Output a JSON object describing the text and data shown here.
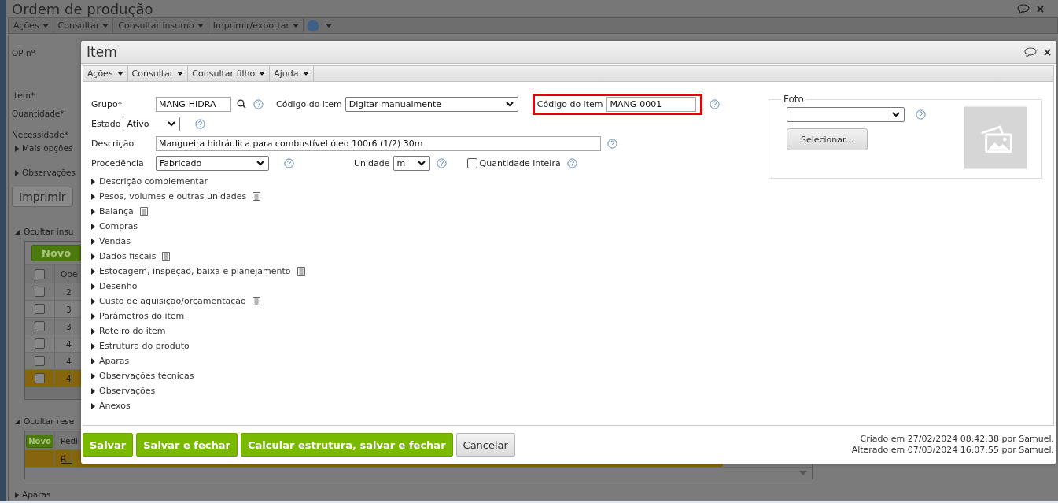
{
  "background_window": {
    "title": "Ordem de produção",
    "menu": [
      "Ações",
      "Consultar",
      "Consultar insumo",
      "Imprimir/exportar"
    ],
    "labels": [
      "OP nº",
      "Item*",
      "Quantidade*",
      "Necessidade*"
    ],
    "more_options": "Mais opções",
    "observations": "Observações",
    "print_button": "Imprimir",
    "inputs_section": {
      "toggle": "Ocultar insu",
      "new_button": "Novo",
      "column_2": "Ope",
      "all_checked": false,
      "rows": [
        {
          "cell": "2",
          "checked": false,
          "selected": false
        },
        {
          "cell": "3",
          "checked": false,
          "selected": false
        },
        {
          "cell": "3",
          "checked": false,
          "selected": false
        },
        {
          "cell": "4",
          "checked": false,
          "selected": false
        },
        {
          "cell": "4",
          "checked": false,
          "selected": false
        },
        {
          "cell": "4",
          "checked": false,
          "selected": true
        }
      ]
    },
    "reservations_section": {
      "toggle": "Ocultar rese",
      "new_button": "Novo",
      "column_2": "Pedi",
      "rows": [
        {
          "cell": "R -",
          "selected": true
        }
      ]
    },
    "next_section": "Aparas"
  },
  "dialog": {
    "title": "Item",
    "menu": [
      "Ações",
      "Consultar",
      "Consultar filho",
      "Ajuda"
    ],
    "group": {
      "label": "Grupo*",
      "value": "MANG-HIDRA"
    },
    "code_mode": {
      "label": "Código do item",
      "value": "Digitar manualmente"
    },
    "code": {
      "label": "Código do item",
      "value": "MANG-0001"
    },
    "state": {
      "label": "Estado",
      "value": "Ativo"
    },
    "description": {
      "label": "Descrição",
      "value": "Mangueira hidráulica para combustível óleo 100r6 (1/2) 30m"
    },
    "origin": {
      "label": "Procedência",
      "value": "Fabricado"
    },
    "unit": {
      "label": "Unidade",
      "value": "m"
    },
    "whole_quantity": {
      "label": "Quantidade inteira",
      "checked": false
    },
    "photo": {
      "legend": "Foto",
      "button": "Selecionar..."
    },
    "sections": [
      {
        "label": "Descrição complementar",
        "doc_icon": false
      },
      {
        "label": "Pesos, volumes e outras unidades",
        "doc_icon": true
      },
      {
        "label": "Balança",
        "doc_icon": true
      },
      {
        "label": "Compras",
        "doc_icon": false
      },
      {
        "label": "Vendas",
        "doc_icon": false
      },
      {
        "label": "Dados fiscais",
        "doc_icon": true
      },
      {
        "label": "Estocagem, inspeção, baixa e planejamento",
        "doc_icon": true
      },
      {
        "label": "Desenho",
        "doc_icon": false
      },
      {
        "label": "Custo de aquisição/orçamentação",
        "doc_icon": true
      },
      {
        "label": "Parâmetros do item",
        "doc_icon": false
      },
      {
        "label": "Roteiro do item",
        "doc_icon": false
      },
      {
        "label": "Estrutura do produto",
        "doc_icon": false
      },
      {
        "label": "Aparas",
        "doc_icon": false
      },
      {
        "label": "Observações técnicas",
        "doc_icon": false
      },
      {
        "label": "Observações",
        "doc_icon": false
      },
      {
        "label": "Anexos",
        "doc_icon": false
      }
    ],
    "buttons": [
      {
        "label": "Salvar",
        "kind": "primary"
      },
      {
        "label": "Salvar e fechar",
        "kind": "primary"
      },
      {
        "label": "Calcular estrutura, salvar e fechar",
        "kind": "primary"
      },
      {
        "label": "Cancelar",
        "kind": "secondary"
      }
    ],
    "audit": [
      "Criado em 27/02/2024 08:42:38 por Samuel.",
      "Alterado em 07/03/2024 16:07:55 por Samuel."
    ]
  }
}
